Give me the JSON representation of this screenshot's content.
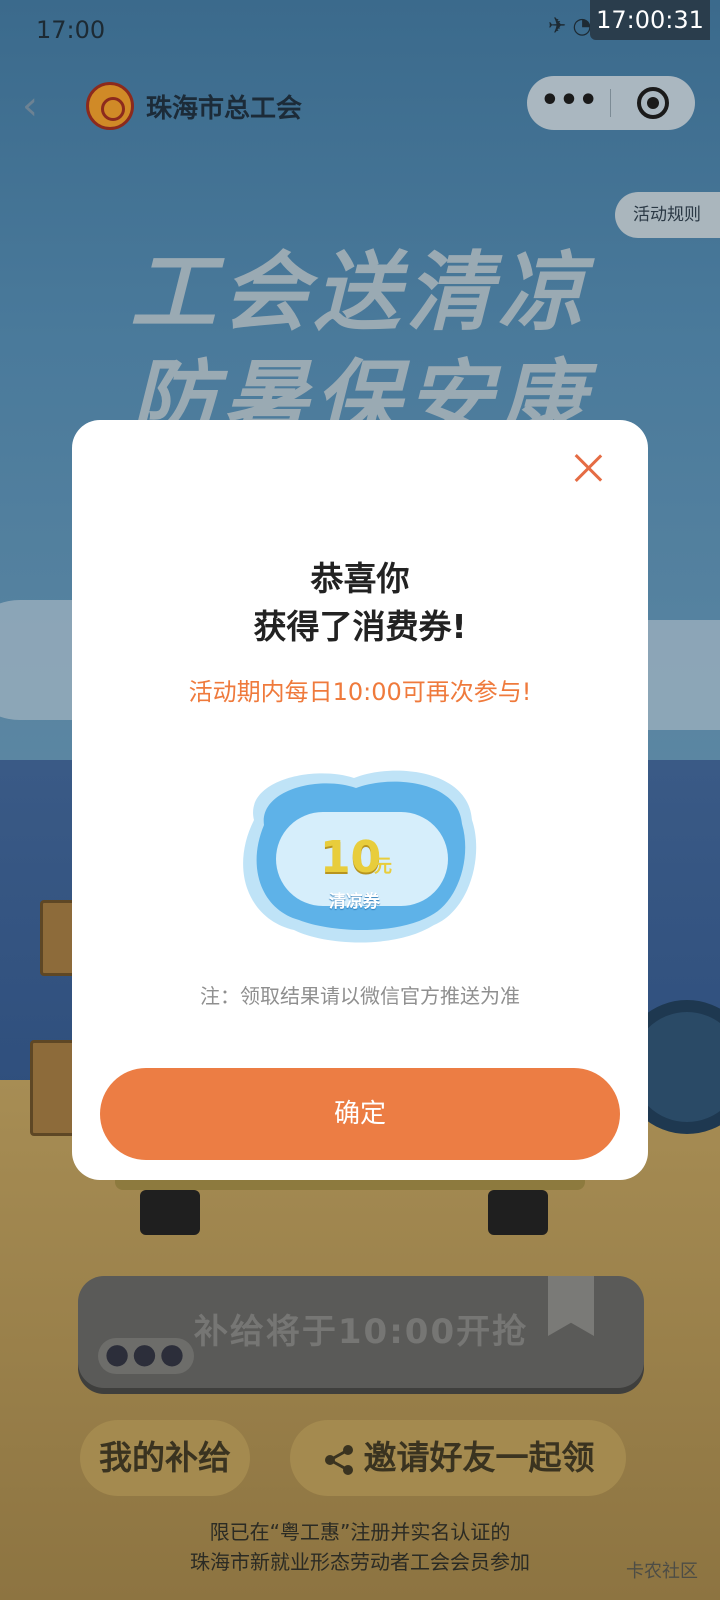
{
  "status_bar": {
    "time": "17:00",
    "clock_overlay": "17:00:31",
    "icons": [
      "airplane-icon",
      "wifi-icon",
      "battery-icon"
    ]
  },
  "nav": {
    "org_name": "珠海市总工会",
    "rules_label": "活动规则",
    "capsule_more": "•••"
  },
  "background": {
    "title_line1": "工会送清凉",
    "title_line2": "防暑保安康"
  },
  "modal": {
    "title_line1": "恭喜你",
    "title_line2": "获得了消费券!",
    "subtitle": "活动期内每日10:00可再次参与!",
    "voucher": {
      "amount": "10",
      "unit": "元",
      "name": "清凉券"
    },
    "note": "注：领取结果请以微信官方推送为准",
    "confirm_label": "确定"
  },
  "bottom": {
    "grab_label": "补给将于10:00开抢",
    "grab_dots": "●●●",
    "my_supply": "我的补给",
    "invite": "邀请好友一起领",
    "notice_line1": "限已在“粤工惠”注册并实名认证的",
    "notice_line2": "珠海市新就业形态劳动者工会会员参加",
    "watermark": "卡农社区"
  },
  "colors": {
    "accent": "#ec7d44",
    "subtitle": "#ef7a3c",
    "close": "#e56c44"
  }
}
